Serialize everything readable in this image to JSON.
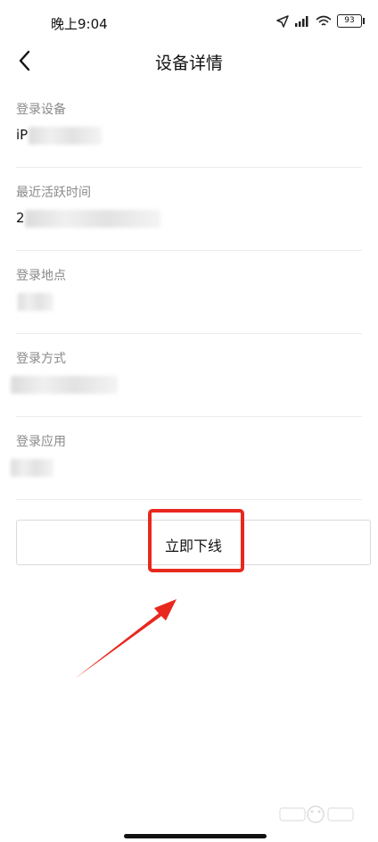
{
  "status": {
    "time": "晚上9:04",
    "battery": "93"
  },
  "header": {
    "title": "设备详情"
  },
  "details": [
    {
      "label": "登录设备",
      "value": "iP"
    },
    {
      "label": "最近活跃时间",
      "value": "2"
    },
    {
      "label": "登录地点",
      "value": ""
    },
    {
      "label": "登录方式",
      "value": ""
    },
    {
      "label": "登录应用",
      "value": ""
    }
  ],
  "actions": {
    "offline_label": "立即下线"
  },
  "colors": {
    "annotation": "#e8281d",
    "divider": "#ececec",
    "label": "#8a8a8a"
  }
}
